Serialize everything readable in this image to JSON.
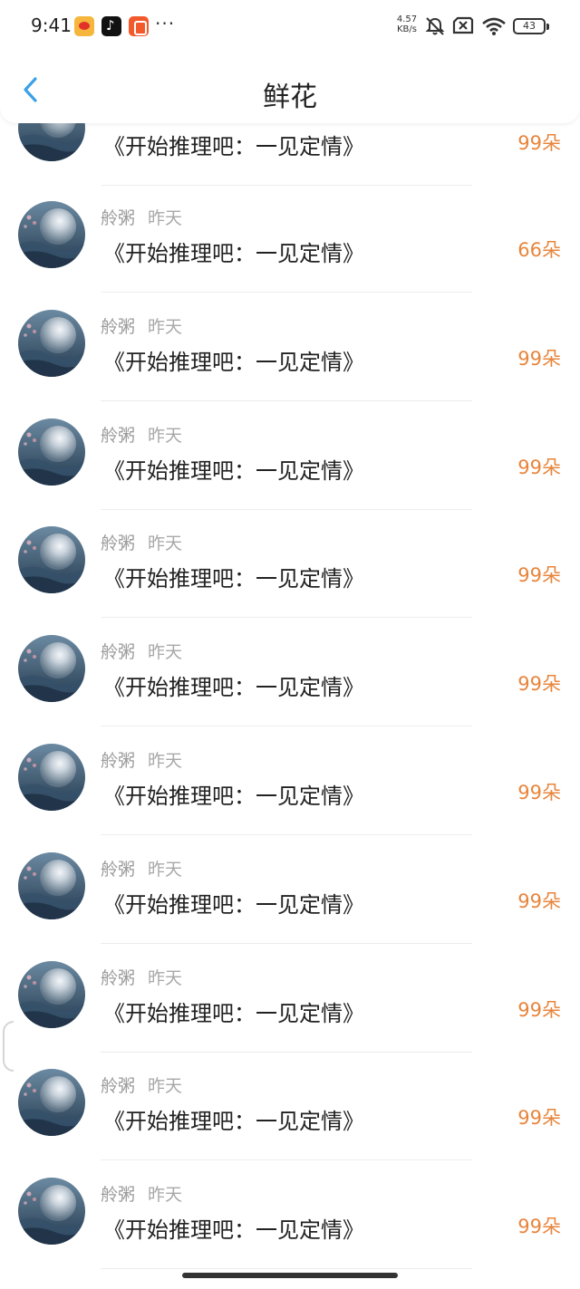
{
  "status_bar": {
    "time": "9:41",
    "network_speed": "4.57",
    "network_unit": "KB/s",
    "battery": "43",
    "apps": [
      "weibo-icon",
      "tiktok-icon",
      "shop-icon"
    ],
    "more": "···"
  },
  "header": {
    "title": "鲜花",
    "back_icon": "chevron-left-icon",
    "accent_color": "#3aa1e6"
  },
  "colors": {
    "amount": "#e8853c",
    "meta": "#9a9a9a"
  },
  "items": [
    {
      "name": "",
      "when": "",
      "book": "《开始推理吧：一见定情》",
      "amount": "99朵"
    },
    {
      "name": "舲粥",
      "when": "昨天",
      "book": "《开始推理吧：一见定情》",
      "amount": "66朵"
    },
    {
      "name": "舲粥",
      "when": "昨天",
      "book": "《开始推理吧：一见定情》",
      "amount": "99朵"
    },
    {
      "name": "舲粥",
      "when": "昨天",
      "book": "《开始推理吧：一见定情》",
      "amount": "99朵"
    },
    {
      "name": "舲粥",
      "when": "昨天",
      "book": "《开始推理吧：一见定情》",
      "amount": "99朵"
    },
    {
      "name": "舲粥",
      "when": "昨天",
      "book": "《开始推理吧：一见定情》",
      "amount": "99朵"
    },
    {
      "name": "舲粥",
      "when": "昨天",
      "book": "《开始推理吧：一见定情》",
      "amount": "99朵"
    },
    {
      "name": "舲粥",
      "when": "昨天",
      "book": "《开始推理吧：一见定情》",
      "amount": "99朵"
    },
    {
      "name": "舲粥",
      "when": "昨天",
      "book": "《开始推理吧：一见定情》",
      "amount": "99朵"
    },
    {
      "name": "舲粥",
      "when": "昨天",
      "book": "《开始推理吧：一见定情》",
      "amount": "99朵"
    },
    {
      "name": "舲粥",
      "when": "昨天",
      "book": "《开始推理吧：一见定情》",
      "amount": "99朵"
    }
  ]
}
